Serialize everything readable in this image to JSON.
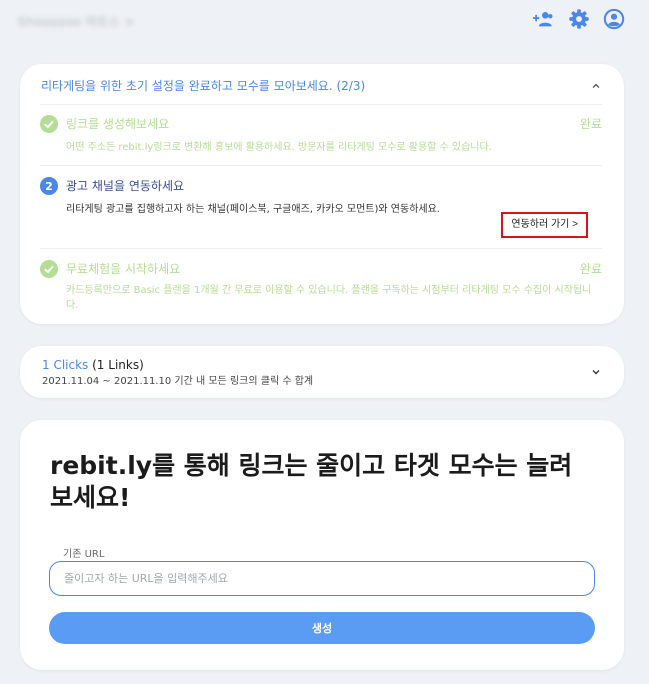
{
  "header": {
    "account_name": "Shoooooo 마트스 >",
    "icons": [
      "add-user-icon",
      "settings-gear-icon",
      "account-circle-icon"
    ],
    "accent_color": "#4a87e8"
  },
  "setup": {
    "title": "리타게팅을 위한 초기 설정을 완료하고 모수를 모아보세요. (2/3)",
    "steps": [
      {
        "state": "done",
        "title": "링크를 생성해보세요",
        "desc": "어떤 주소든 rebit.ly링크로 변환해 홍보에 활용하세요. 방문자를 리타게팅 모수로 활용할 수 있습니다.",
        "status": "완료"
      },
      {
        "state": "active",
        "number": "2",
        "title": "광고 채널을 연동하세요",
        "desc": "리타게팅 광고를 집행하고자 하는 채널(페이스북, 구글애즈, 카카오 모먼트)와 연동하세요.",
        "action_label": "연동하러 가기 >"
      },
      {
        "state": "done",
        "title": "무료체험을 시작하세요",
        "desc": "카드등록만으로 Basic 플랜을 1개월 간 무료로 이용할 수 있습니다. 플랜을 구독하는 시점부터 리타게팅 모수 수집이 시작됩니다.",
        "status": "완료"
      }
    ]
  },
  "clicks": {
    "count_label": "1 Clicks",
    "links_label": "(1 Links)",
    "range_label": "2021.11.04 ~ 2021.11.10 기간 내 모든 링크의 클릭 수 합계"
  },
  "create": {
    "headline": "rebit.ly를 통해 링크는 줄이고 타겟 모수는 늘려보세요!",
    "field_label": "기존 URL",
    "input_value": "",
    "input_placeholder": "줄이고자 하는 URL을 입력해주세요",
    "button_label": "생성"
  },
  "colors": {
    "primary": "#4a87e8",
    "button": "#5a9cf3",
    "done_green": "#b4dd95",
    "highlight_red": "#d8141b"
  }
}
